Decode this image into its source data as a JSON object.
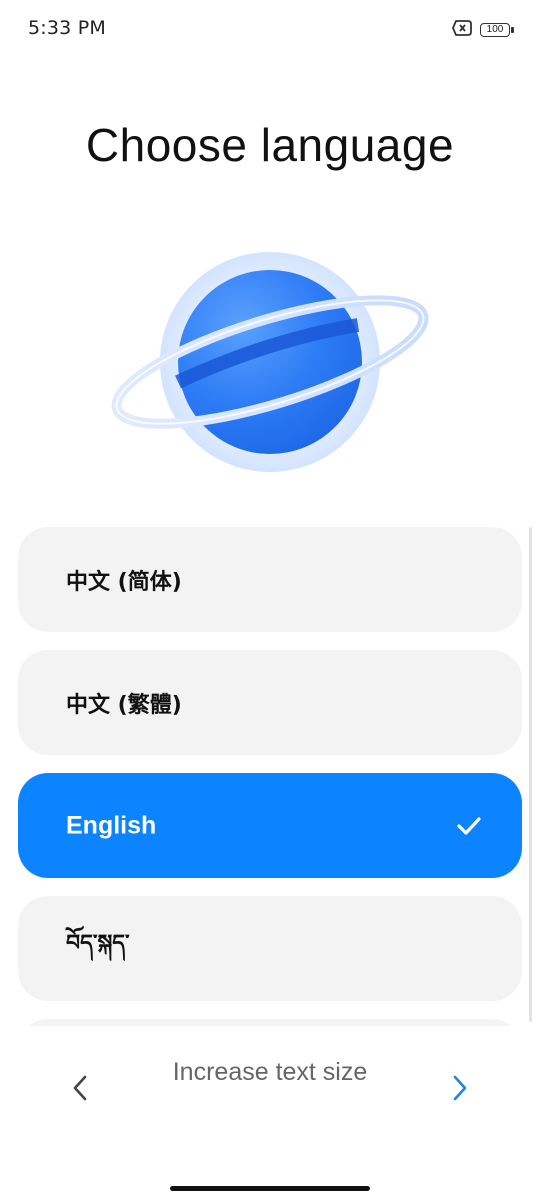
{
  "status_bar": {
    "time": "5:33 PM",
    "battery_level": "100",
    "icons": [
      "no-sim-icon",
      "battery-icon"
    ]
  },
  "title": "Choose language",
  "languages": [
    {
      "label": "中文 (简体)",
      "selected": false
    },
    {
      "label": "中文 (繁體)",
      "selected": false
    },
    {
      "label": "English",
      "selected": true
    },
    {
      "label": "བོད་སྐད་",
      "selected": false
    }
  ],
  "bottom_bar": {
    "text_size_label": "Increase text size",
    "back_icon": "chevron-left-icon",
    "next_icon": "chevron-right-icon"
  },
  "colors": {
    "accent": "#0d84ff",
    "item_background": "#f3f3f3",
    "next_arrow": "#1a86e6"
  }
}
